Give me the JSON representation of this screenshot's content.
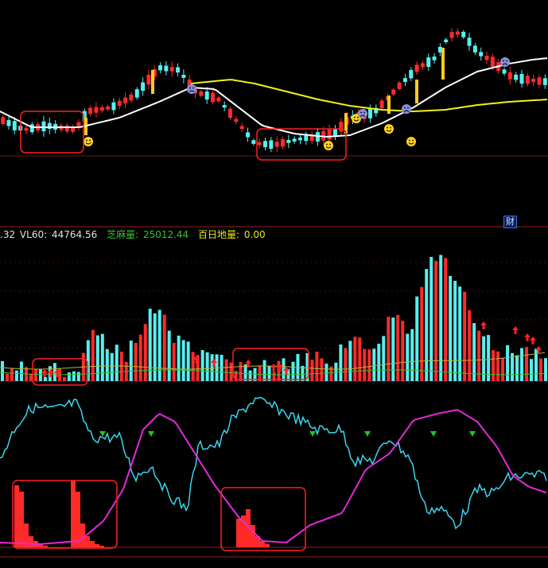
{
  "legend": {
    "vol_fragment": ".32",
    "vl60_label": "VL60:",
    "vl60_value": "44764.56",
    "zhima_label": "芝麻量:",
    "zhima_value": "25012.44",
    "bairi_label": "百日地量:",
    "bairi_value": "0.00"
  },
  "badge_text": "财",
  "colors": {
    "background": "#000000",
    "up": "#ff2a2a",
    "down": "#55f0f0",
    "ma_white": "#ffffff",
    "ma_yellow": "#f2f21a",
    "vl60_line": "#b6b63a",
    "zhima_line": "#2fc52f",
    "osc_cyan": "#3ad6ee",
    "osc_magenta": "#e22ad6",
    "divider": "#9a1c1c",
    "highlight_box": "#ff1f1f",
    "buy_face": "#ffd21a",
    "sell_face": "#8a8fd8",
    "arrow_red": "#ff2020",
    "triangle_green": "#25c325",
    "flat_gridline": "#5a1a1a"
  },
  "chart_data": [
    {
      "type": "candlestick",
      "panel": "price",
      "title": "",
      "overlays": [
        {
          "name": "",
          "kind": "moving-average",
          "color": "white"
        },
        {
          "name": "",
          "kind": "moving-average",
          "color": "yellow"
        }
      ],
      "markers": [
        {
          "kind": "smiley-buy",
          "count": 5
        },
        {
          "kind": "frown-sell",
          "count": 5
        }
      ],
      "highlight_boxes": 2,
      "bars": 94
    },
    {
      "type": "bar",
      "panel": "volume",
      "series": [
        {
          "name": "VL60",
          "value": 44764.56
        },
        {
          "name": "芝麻量",
          "value": 25012.44
        },
        {
          "name": "百日地量",
          "value": 0.0
        }
      ],
      "markers": [
        {
          "kind": "red-up-arrow"
        }
      ],
      "highlight_boxes": 2
    },
    {
      "type": "line",
      "panel": "oscillator",
      "series": [
        {
          "name": "",
          "color": "cyan"
        },
        {
          "name": "",
          "color": "magenta"
        },
        {
          "name": "",
          "kind": "red-histogram"
        }
      ],
      "markers": [
        {
          "kind": "green-down-triangle",
          "count": 6
        }
      ],
      "highlight_boxes": 2
    }
  ]
}
